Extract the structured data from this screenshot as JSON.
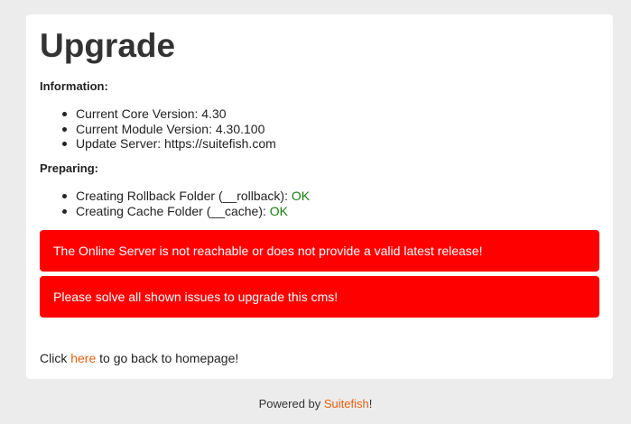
{
  "page": {
    "title": "Upgrade"
  },
  "information": {
    "heading": "Information:",
    "items": [
      "Current Core Version: 4.30",
      "Current Module Version: 4.30.100",
      "Update Server: https://suitefish.com"
    ]
  },
  "preparing": {
    "heading": "Preparing:",
    "items": [
      {
        "label": "Creating Rollback Folder (__rollback): ",
        "status": "OK"
      },
      {
        "label": "Creating Cache Folder (__cache): ",
        "status": "OK"
      }
    ]
  },
  "alerts": [
    "The Online Server is not reachable or does not provide a valid latest release!",
    "Please solve all shown issues to upgrade this cms!"
  ],
  "back": {
    "prefix": "Click ",
    "link_text": "here",
    "suffix": " to go back to homepage!"
  },
  "footer": {
    "prefix": "Powered by ",
    "link_text": "Suitefish",
    "suffix": "!"
  },
  "colors": {
    "alert_bg": "#ff0000",
    "ok": "#13800d",
    "link": "#e8600e"
  }
}
